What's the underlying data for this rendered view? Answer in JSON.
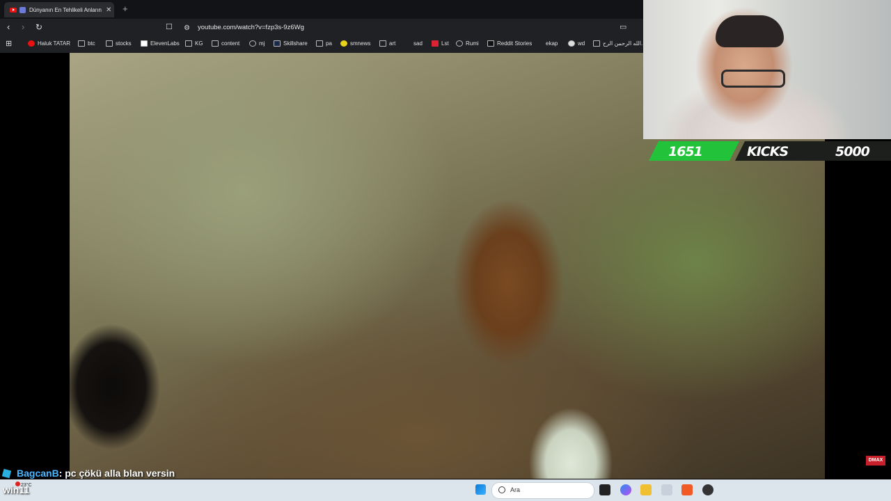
{
  "browser": {
    "tab_title": "Dünyanın En Tehlikeli Anların",
    "new_tab": "+",
    "url": "youtube.com/watch?v=fzp3s-9z6Wg",
    "bookmarks": [
      "Haluk TATAR",
      "btc",
      "stocks",
      "ElevenLabs",
      "KG",
      "content",
      "mj",
      "Skillshare",
      "pa",
      "smnews",
      "art",
      "sad",
      "Lst",
      "Rumi",
      "Reddit Stories",
      "ekap",
      "wd",
      "الله الرحمن الرح..."
    ]
  },
  "stream": {
    "kicks_current": "1651",
    "kicks_label": "KICKS",
    "kicks_goal": "5000",
    "kicks_progress": 0.33,
    "chat_user": "BagcanB",
    "chat_message": ": pc çökü alla blan versin",
    "watermark": "DMAX"
  },
  "taskbar": {
    "search_placeholder": "Ara",
    "weather_label": "win11",
    "weather_temp": "23°C"
  },
  "colors": {
    "kicks_green": "#22c33a",
    "chat_user": "#49b7ff"
  }
}
